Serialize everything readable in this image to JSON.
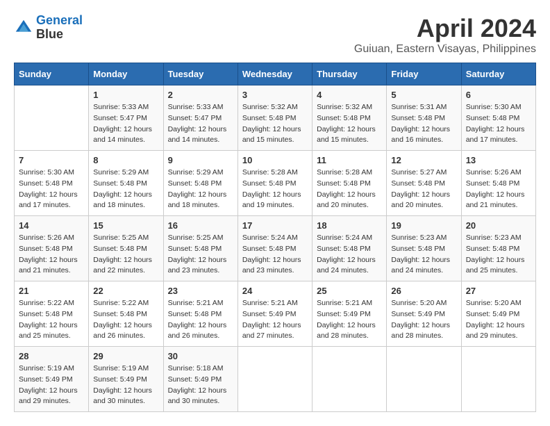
{
  "logo": {
    "line1": "General",
    "line2": "Blue"
  },
  "title": "April 2024",
  "subtitle": "Guiuan, Eastern Visayas, Philippines",
  "days_of_week": [
    "Sunday",
    "Monday",
    "Tuesday",
    "Wednesday",
    "Thursday",
    "Friday",
    "Saturday"
  ],
  "weeks": [
    [
      {
        "day": "",
        "sunrise": "",
        "sunset": "",
        "daylight": ""
      },
      {
        "day": "1",
        "sunrise": "Sunrise: 5:33 AM",
        "sunset": "Sunset: 5:47 PM",
        "daylight": "Daylight: 12 hours and 14 minutes."
      },
      {
        "day": "2",
        "sunrise": "Sunrise: 5:33 AM",
        "sunset": "Sunset: 5:47 PM",
        "daylight": "Daylight: 12 hours and 14 minutes."
      },
      {
        "day": "3",
        "sunrise": "Sunrise: 5:32 AM",
        "sunset": "Sunset: 5:48 PM",
        "daylight": "Daylight: 12 hours and 15 minutes."
      },
      {
        "day": "4",
        "sunrise": "Sunrise: 5:32 AM",
        "sunset": "Sunset: 5:48 PM",
        "daylight": "Daylight: 12 hours and 15 minutes."
      },
      {
        "day": "5",
        "sunrise": "Sunrise: 5:31 AM",
        "sunset": "Sunset: 5:48 PM",
        "daylight": "Daylight: 12 hours and 16 minutes."
      },
      {
        "day": "6",
        "sunrise": "Sunrise: 5:30 AM",
        "sunset": "Sunset: 5:48 PM",
        "daylight": "Daylight: 12 hours and 17 minutes."
      }
    ],
    [
      {
        "day": "7",
        "sunrise": "Sunrise: 5:30 AM",
        "sunset": "Sunset: 5:48 PM",
        "daylight": "Daylight: 12 hours and 17 minutes."
      },
      {
        "day": "8",
        "sunrise": "Sunrise: 5:29 AM",
        "sunset": "Sunset: 5:48 PM",
        "daylight": "Daylight: 12 hours and 18 minutes."
      },
      {
        "day": "9",
        "sunrise": "Sunrise: 5:29 AM",
        "sunset": "Sunset: 5:48 PM",
        "daylight": "Daylight: 12 hours and 18 minutes."
      },
      {
        "day": "10",
        "sunrise": "Sunrise: 5:28 AM",
        "sunset": "Sunset: 5:48 PM",
        "daylight": "Daylight: 12 hours and 19 minutes."
      },
      {
        "day": "11",
        "sunrise": "Sunrise: 5:28 AM",
        "sunset": "Sunset: 5:48 PM",
        "daylight": "Daylight: 12 hours and 20 minutes."
      },
      {
        "day": "12",
        "sunrise": "Sunrise: 5:27 AM",
        "sunset": "Sunset: 5:48 PM",
        "daylight": "Daylight: 12 hours and 20 minutes."
      },
      {
        "day": "13",
        "sunrise": "Sunrise: 5:26 AM",
        "sunset": "Sunset: 5:48 PM",
        "daylight": "Daylight: 12 hours and 21 minutes."
      }
    ],
    [
      {
        "day": "14",
        "sunrise": "Sunrise: 5:26 AM",
        "sunset": "Sunset: 5:48 PM",
        "daylight": "Daylight: 12 hours and 21 minutes."
      },
      {
        "day": "15",
        "sunrise": "Sunrise: 5:25 AM",
        "sunset": "Sunset: 5:48 PM",
        "daylight": "Daylight: 12 hours and 22 minutes."
      },
      {
        "day": "16",
        "sunrise": "Sunrise: 5:25 AM",
        "sunset": "Sunset: 5:48 PM",
        "daylight": "Daylight: 12 hours and 23 minutes."
      },
      {
        "day": "17",
        "sunrise": "Sunrise: 5:24 AM",
        "sunset": "Sunset: 5:48 PM",
        "daylight": "Daylight: 12 hours and 23 minutes."
      },
      {
        "day": "18",
        "sunrise": "Sunrise: 5:24 AM",
        "sunset": "Sunset: 5:48 PM",
        "daylight": "Daylight: 12 hours and 24 minutes."
      },
      {
        "day": "19",
        "sunrise": "Sunrise: 5:23 AM",
        "sunset": "Sunset: 5:48 PM",
        "daylight": "Daylight: 12 hours and 24 minutes."
      },
      {
        "day": "20",
        "sunrise": "Sunrise: 5:23 AM",
        "sunset": "Sunset: 5:48 PM",
        "daylight": "Daylight: 12 hours and 25 minutes."
      }
    ],
    [
      {
        "day": "21",
        "sunrise": "Sunrise: 5:22 AM",
        "sunset": "Sunset: 5:48 PM",
        "daylight": "Daylight: 12 hours and 25 minutes."
      },
      {
        "day": "22",
        "sunrise": "Sunrise: 5:22 AM",
        "sunset": "Sunset: 5:48 PM",
        "daylight": "Daylight: 12 hours and 26 minutes."
      },
      {
        "day": "23",
        "sunrise": "Sunrise: 5:21 AM",
        "sunset": "Sunset: 5:48 PM",
        "daylight": "Daylight: 12 hours and 26 minutes."
      },
      {
        "day": "24",
        "sunrise": "Sunrise: 5:21 AM",
        "sunset": "Sunset: 5:49 PM",
        "daylight": "Daylight: 12 hours and 27 minutes."
      },
      {
        "day": "25",
        "sunrise": "Sunrise: 5:21 AM",
        "sunset": "Sunset: 5:49 PM",
        "daylight": "Daylight: 12 hours and 28 minutes."
      },
      {
        "day": "26",
        "sunrise": "Sunrise: 5:20 AM",
        "sunset": "Sunset: 5:49 PM",
        "daylight": "Daylight: 12 hours and 28 minutes."
      },
      {
        "day": "27",
        "sunrise": "Sunrise: 5:20 AM",
        "sunset": "Sunset: 5:49 PM",
        "daylight": "Daylight: 12 hours and 29 minutes."
      }
    ],
    [
      {
        "day": "28",
        "sunrise": "Sunrise: 5:19 AM",
        "sunset": "Sunset: 5:49 PM",
        "daylight": "Daylight: 12 hours and 29 minutes."
      },
      {
        "day": "29",
        "sunrise": "Sunrise: 5:19 AM",
        "sunset": "Sunset: 5:49 PM",
        "daylight": "Daylight: 12 hours and 30 minutes."
      },
      {
        "day": "30",
        "sunrise": "Sunrise: 5:18 AM",
        "sunset": "Sunset: 5:49 PM",
        "daylight": "Daylight: 12 hours and 30 minutes."
      },
      {
        "day": "",
        "sunrise": "",
        "sunset": "",
        "daylight": ""
      },
      {
        "day": "",
        "sunrise": "",
        "sunset": "",
        "daylight": ""
      },
      {
        "day": "",
        "sunrise": "",
        "sunset": "",
        "daylight": ""
      },
      {
        "day": "",
        "sunrise": "",
        "sunset": "",
        "daylight": ""
      }
    ]
  ]
}
